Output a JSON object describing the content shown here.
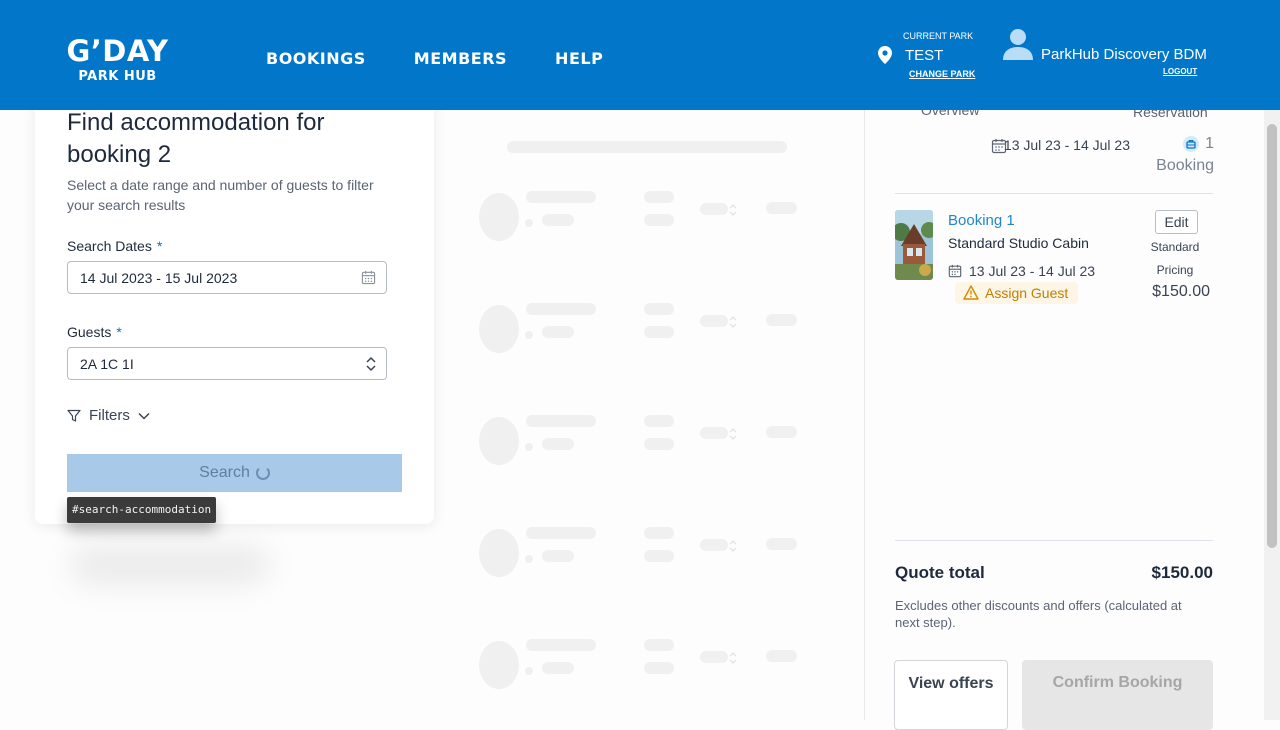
{
  "header": {
    "logo_main": "G’DAY",
    "logo_sub": "PARK HUB",
    "nav": [
      "BOOKINGS",
      "MEMBERS",
      "HELP"
    ],
    "park_caption": "CURRENT PARK",
    "park_name": "TEST",
    "change_park": "CHANGE PARK",
    "user_name": "ParkHub Discovery BDM",
    "logout": "LOGOUT",
    "brand_color": "#0277c9"
  },
  "search": {
    "title": "Find accommodation for booking 2",
    "description": "Select a date range and number of guests to filter your search results",
    "dates_label": "Search Dates",
    "dates_value": "14 Jul 2023 - 15 Jul 2023",
    "guests_label": "Guests",
    "guests_value": "2A 1C 1I",
    "required_mark": "*",
    "filters_label": "Filters",
    "search_button": "Search",
    "tooltip": "#search-accommodation"
  },
  "summary": {
    "overview_label": "Overview",
    "reservation_label": "Reservation",
    "overview_dates": "13 Jul 23 - 14 Jul 23",
    "booking_count": "1 Booking",
    "booking": {
      "link": "Booking 1",
      "room": "Standard Studio Cabin",
      "dates": "13 Jul 23 - 14 Jul 23",
      "assign_guest": "Assign Guest",
      "edit": "Edit",
      "pricing": "Standard Pricing",
      "price": "$150.00"
    },
    "quote_label": "Quote total",
    "quote_value": "$150.00",
    "quote_note": "Excludes other discounts and offers (calculated at next step).",
    "view_offers": "View offers",
    "confirm_booking": "Confirm Booking"
  }
}
